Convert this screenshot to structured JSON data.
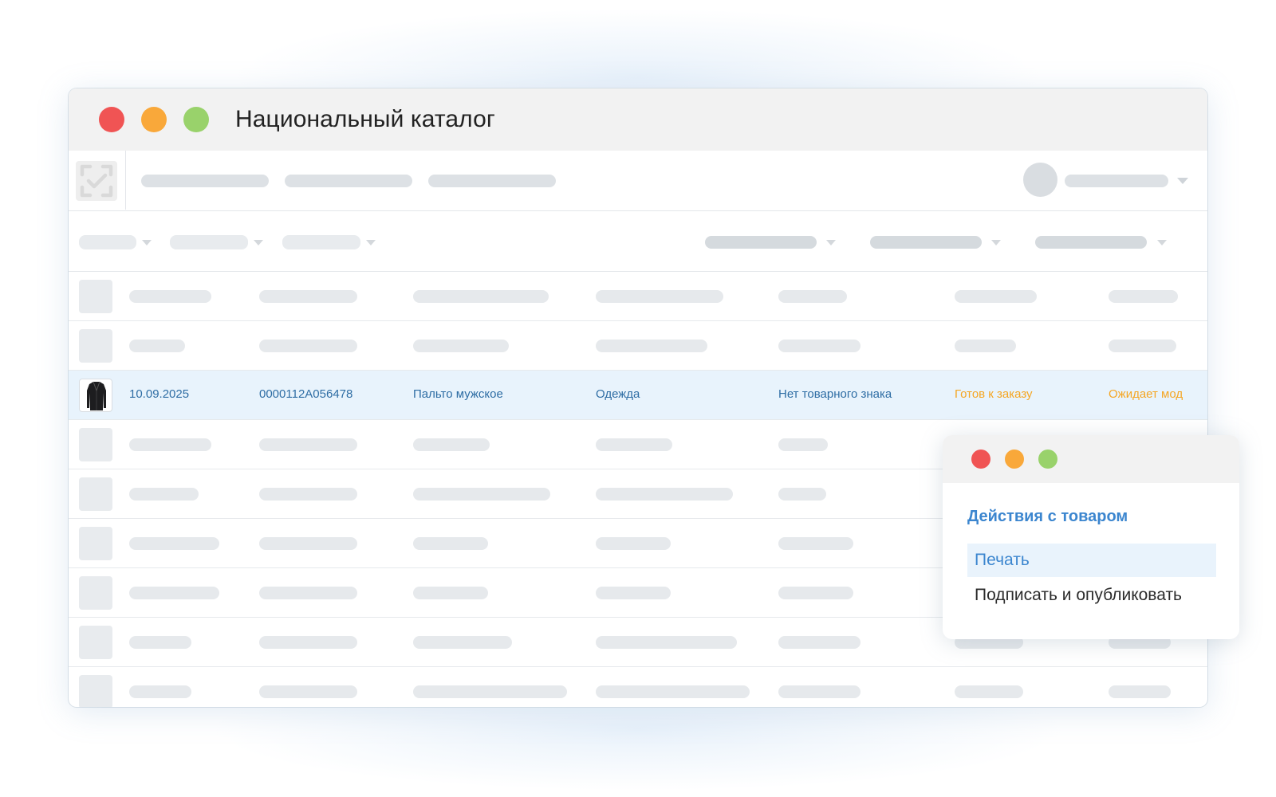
{
  "window": {
    "title": "Национальный каталог",
    "controls": {
      "close_color": "#f05454",
      "minimize_color": "#f9a83a",
      "zoom_color": "#99d26b"
    }
  },
  "table": {
    "highlighted_row": {
      "date": "10.09.2025",
      "code": "0000112A056478",
      "name": "Пальто мужское",
      "category": "Одежда",
      "trademark": "Нет товарного знака",
      "status": "Готов к заказу",
      "moderation": "Ожидает мод",
      "status_color": "#f5a623",
      "link_color": "#2e6da4"
    }
  },
  "popup": {
    "title": "Действия с товаром",
    "items": [
      "Печать",
      "Подписать и опубликовать"
    ],
    "accent_color": "#3c86cf"
  },
  "icons": {
    "logo": "check-scan-icon",
    "product_thumb": "coat-icon"
  }
}
